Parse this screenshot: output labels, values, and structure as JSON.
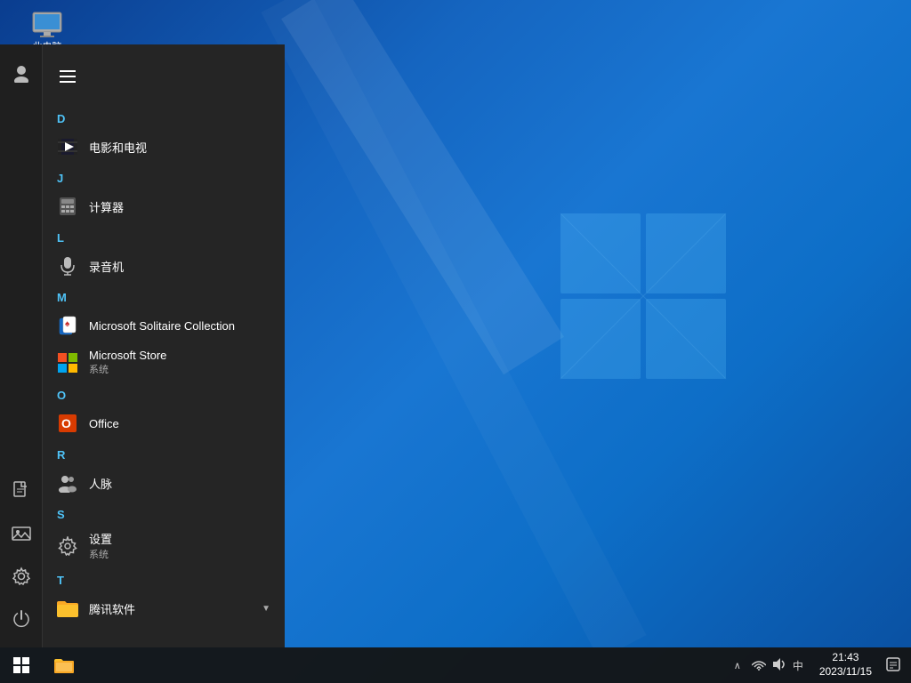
{
  "desktop": {
    "background": "Windows 10 blue",
    "icon": {
      "label": "此电脑",
      "name": "this-pc-icon"
    }
  },
  "start_menu": {
    "hamburger": "☰",
    "sections": [
      {
        "letter": "D",
        "items": [
          {
            "id": "movies-tv",
            "name": "电影和电视",
            "icon": "film",
            "subtitle": ""
          }
        ]
      },
      {
        "letter": "J",
        "items": [
          {
            "id": "calculator",
            "name": "计算器",
            "icon": "calc",
            "subtitle": ""
          }
        ]
      },
      {
        "letter": "L",
        "items": [
          {
            "id": "recorder",
            "name": "录音机",
            "icon": "mic",
            "subtitle": ""
          }
        ]
      },
      {
        "letter": "M",
        "items": [
          {
            "id": "solitaire",
            "name": "Microsoft Solitaire Collection",
            "icon": "cards",
            "subtitle": ""
          },
          {
            "id": "store",
            "name": "Microsoft Store",
            "icon": "store",
            "subtitle": "系统"
          }
        ]
      },
      {
        "letter": "O",
        "items": [
          {
            "id": "office",
            "name": "Office",
            "icon": "office",
            "subtitle": ""
          }
        ]
      },
      {
        "letter": "R",
        "items": [
          {
            "id": "people",
            "name": "人脉",
            "icon": "people",
            "subtitle": ""
          }
        ]
      },
      {
        "letter": "S",
        "items": [
          {
            "id": "settings",
            "name": "设置",
            "icon": "settings",
            "subtitle": "系统"
          }
        ]
      },
      {
        "letter": "T",
        "items": [
          {
            "id": "tencent",
            "name": "腾讯软件",
            "icon": "folder",
            "subtitle": "",
            "hasArrow": true
          }
        ]
      }
    ]
  },
  "sidebar": {
    "items": [
      {
        "id": "profile",
        "icon": "👤",
        "name": "profile-icon"
      },
      {
        "id": "document",
        "icon": "📄",
        "name": "document-icon"
      },
      {
        "id": "photos",
        "icon": "🖼",
        "name": "photos-icon"
      },
      {
        "id": "settings",
        "icon": "⚙",
        "name": "settings-icon"
      },
      {
        "id": "power",
        "icon": "⏻",
        "name": "power-icon"
      }
    ]
  },
  "taskbar": {
    "start_label": "⊞",
    "file_explorer_label": "📁",
    "tray": {
      "chevron": "∧",
      "ime": "中",
      "volume": "🔊",
      "network": "🌐"
    },
    "clock": {
      "time": "21:43",
      "date": "2023/11/15"
    },
    "notification": "🗨"
  }
}
